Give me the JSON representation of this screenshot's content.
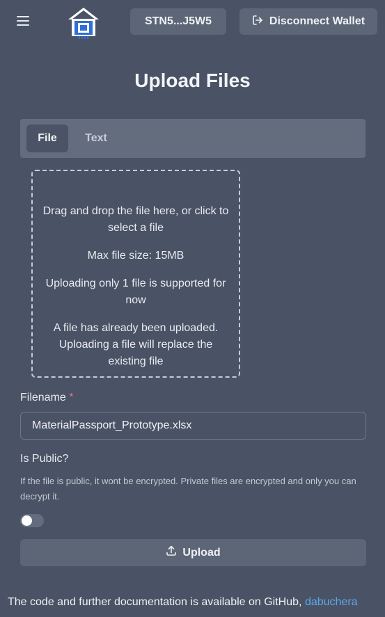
{
  "header": {
    "menu_icon": "hamburger-menu-icon",
    "logo_icon": "house-chip-logo",
    "wallet_address": "STN5...J5W5",
    "disconnect_label": "Disconnect Wallet",
    "disconnect_icon": "logout-icon"
  },
  "page": {
    "title": "Upload Files"
  },
  "tabs": [
    {
      "label": "File",
      "active": true
    },
    {
      "label": "Text",
      "active": false
    }
  ],
  "dropzone": {
    "line1": "Drag and drop the file here, or click to select a file",
    "line2": "Max file size: 15MB",
    "line3": "Uploading only 1 file is supported for now",
    "line4": "A file has already been uploaded. Uploading a file will replace the existing file"
  },
  "form": {
    "filename_label": "Filename",
    "required_mark": "*",
    "filename_value": "MaterialPassport_Prototype.xlsx",
    "public_label": "Is Public?",
    "public_helper": "If the file is public, it wont be encrypted. Private files are encrypted and only you can decrypt it.",
    "public_enabled": false,
    "upload_label": "Upload",
    "upload_icon": "upload-icon"
  },
  "footer": {
    "text": "The code and further documentation is available on GitHub,",
    "link_text": "dabuchera"
  },
  "colors": {
    "background": "#4a5365",
    "button": "#5d6677",
    "link": "#5ea8e8",
    "required": "#e8707a",
    "logo_blue": "#2f6fd6"
  }
}
